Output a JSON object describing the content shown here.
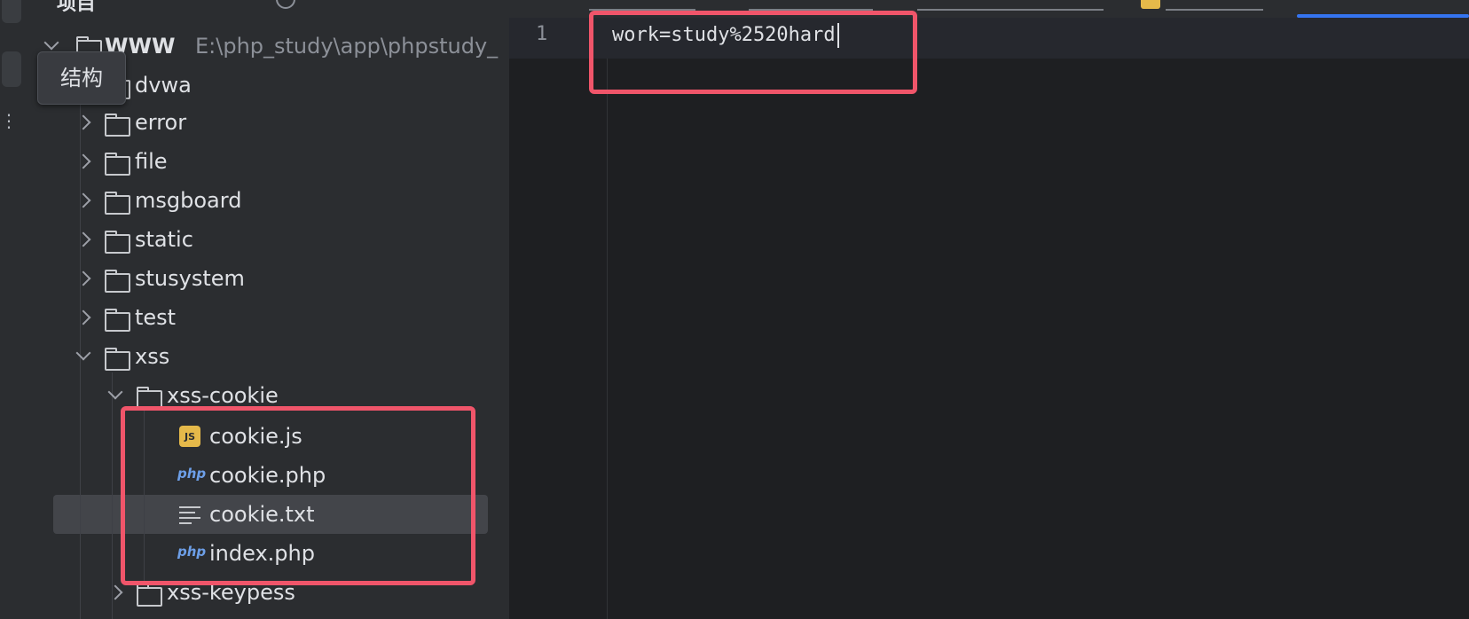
{
  "project_panel": {
    "title": "项目",
    "tooltip": "结构",
    "root": {
      "name": "WWW",
      "path": "E:\\php_study\\app\\phpstudy_"
    },
    "tree": [
      {
        "name": "dvwa",
        "type": "folder",
        "expanded": false
      },
      {
        "name": "error",
        "type": "folder",
        "expanded": false
      },
      {
        "name": "file",
        "type": "folder",
        "expanded": false
      },
      {
        "name": "msgboard",
        "type": "folder",
        "expanded": false
      },
      {
        "name": "static",
        "type": "folder",
        "expanded": false
      },
      {
        "name": "stusystem",
        "type": "folder",
        "expanded": false
      },
      {
        "name": "test",
        "type": "folder",
        "expanded": false
      },
      {
        "name": "xss",
        "type": "folder",
        "expanded": true
      },
      {
        "name": "xss-cookie",
        "type": "folder",
        "expanded": true
      },
      {
        "name": "cookie.js",
        "type": "js-file"
      },
      {
        "name": "cookie.php",
        "type": "php-file"
      },
      {
        "name": "cookie.txt",
        "type": "text-file",
        "selected": true
      },
      {
        "name": "index.php",
        "type": "php-file"
      },
      {
        "name": "xss-keypess",
        "type": "folder",
        "expanded": false
      }
    ],
    "icons": {
      "php": "php",
      "js": "JS"
    }
  },
  "editor": {
    "line_numbers": [
      "1"
    ],
    "lines": [
      "work=study%2520hard"
    ]
  },
  "colors": {
    "panel_bg": "#2b2d30",
    "editor_bg": "#1e1f22",
    "highlight": "#f0556a",
    "selection": "#43454a",
    "accent": "#3574f0"
  }
}
